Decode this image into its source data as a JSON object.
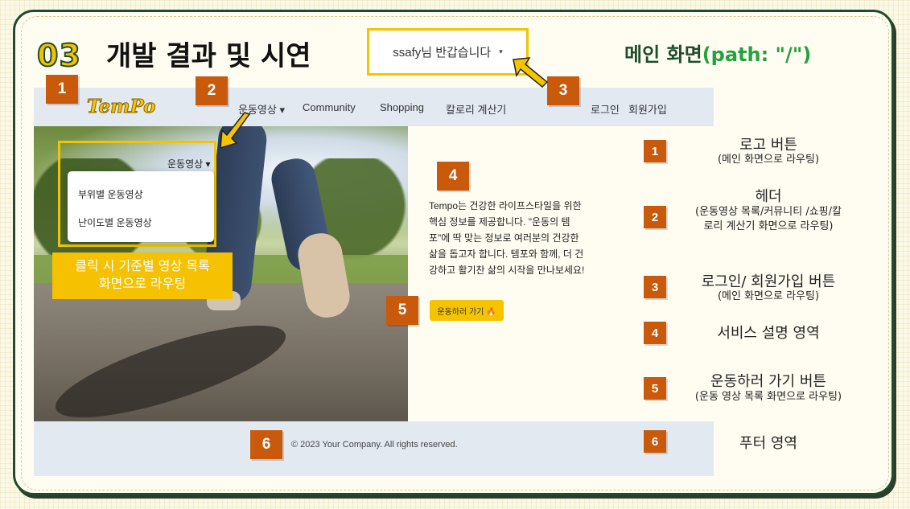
{
  "slide": {
    "number": "03",
    "title": "개발 결과 및 시연",
    "main_title_prefix": "메인 화면",
    "main_title_path": "(path: \"/\")"
  },
  "user_menu": {
    "label": "ssafy님 반갑습니다",
    "caret": "▾"
  },
  "navbar": {
    "logo": "TemPo",
    "items": [
      "운동영상 ▾",
      "Community",
      "Shopping",
      "칼로리 계산기"
    ],
    "right_items": [
      "로그인",
      "회원가입"
    ]
  },
  "hero": {
    "dropdown_toggle": "운동영상 ▾",
    "dropdown_items": [
      "부위별 운동영상",
      "난이도별 운동영상"
    ],
    "callout_line1": "클릭 시 기준별 영상 목록",
    "callout_line2": "화면으로 라우팅"
  },
  "description": "Tempo는 건강한 라이프스타일을 위한 핵심 정보를 제공합니다. \"운동의 템포\"에 딱 맞는 정보로 여러분의 건강한 삶을 돕고자 합니다. 템포와 함께, 더 건강하고 활기찬 삶의 시작을 만나보세요!",
  "cta_button": "운동하러 가기 🔥",
  "footer": {
    "copyright": "© 2023 Your Company. All rights reserved."
  },
  "markers": [
    "1",
    "2",
    "3",
    "4",
    "5",
    "6"
  ],
  "legend": [
    {
      "num": "1",
      "title": "로고 버튼",
      "sub": "(메인 화면으로 라우팅)"
    },
    {
      "num": "2",
      "title": "헤더",
      "sub": "(운동영상 목록/커뮤니티 /쇼핑/칼로리 계산기 화면으로 라우팅)"
    },
    {
      "num": "3",
      "title": "로그인/ 회원가입 버튼",
      "sub": "(메인 화면으로 라우팅)"
    },
    {
      "num": "4",
      "title": "서비스 설명 영역",
      "sub": ""
    },
    {
      "num": "5",
      "title": "운동하러 가기 버튼",
      "sub": "(운동 영상 목록 화면으로 라우팅)"
    },
    {
      "num": "6",
      "title": "푸터 영역",
      "sub": ""
    }
  ],
  "colors": {
    "accent": "#f4c400",
    "badge": "#c95a0c",
    "brand_green": "#1e4d2b",
    "path_green": "#23a33e"
  }
}
